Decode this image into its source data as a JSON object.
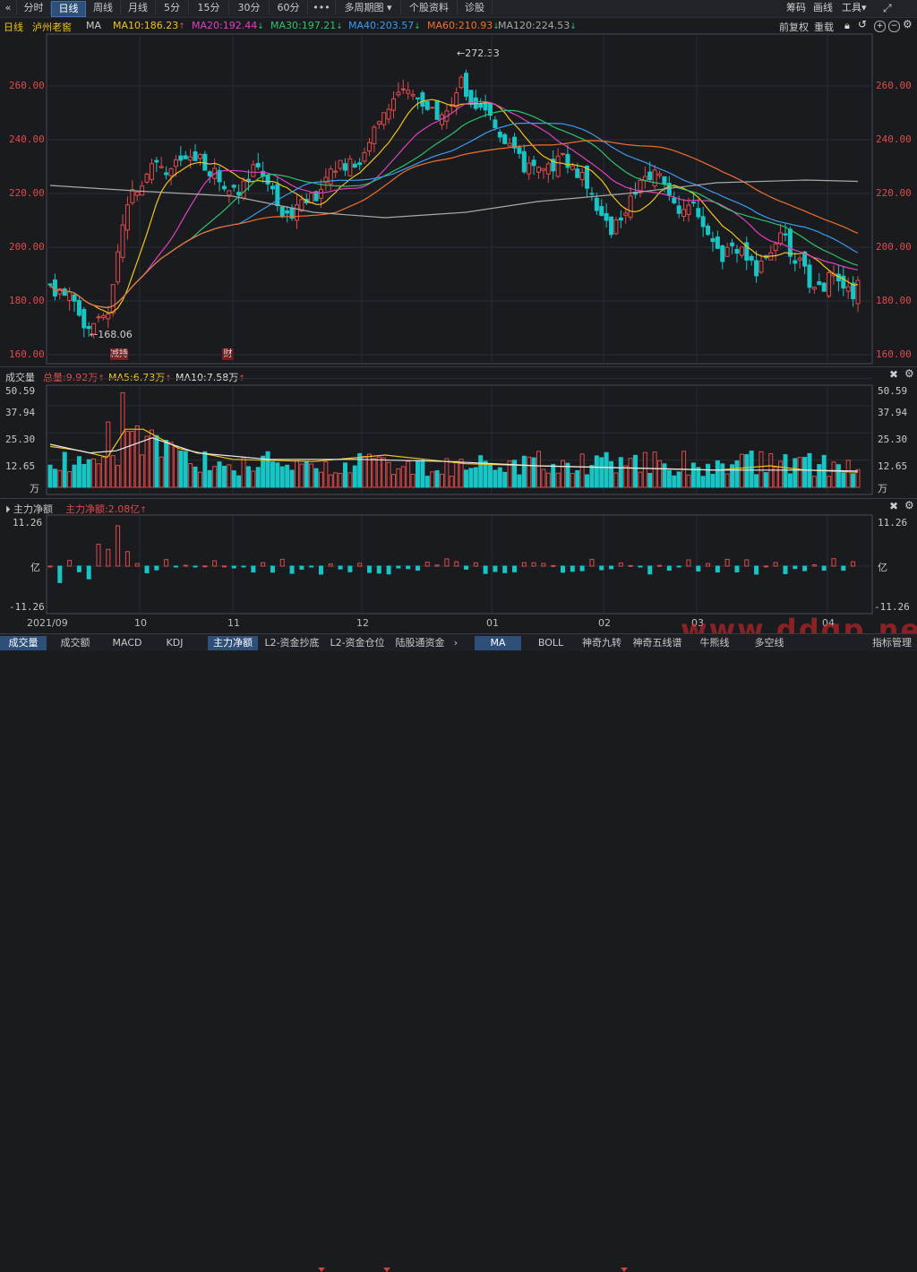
{
  "toolbar": {
    "back_icon": "double-chevron-left-icon",
    "periods": [
      "分时",
      "日线",
      "周线",
      "月线",
      "5分",
      "15分",
      "30分",
      "60分",
      "•••",
      "多周期图",
      "个股资料",
      "诊股"
    ],
    "active_period": "日线",
    "right_items": [
      "筹码",
      "画线",
      "工具"
    ],
    "icons": [
      "chevron-down-icon",
      "expand-icon"
    ]
  },
  "info": {
    "period": "日线",
    "stock_name": "泸州老窖",
    "indicator": "MA",
    "ma_values": [
      {
        "label": "MA10:186.23",
        "color": "#f0c419",
        "dir": "up"
      },
      {
        "label": "MA20:192.44",
        "color": "#e040c0",
        "dir": "down"
      },
      {
        "label": "MA30:197.21",
        "color": "#2ec26b",
        "dir": "down"
      },
      {
        "label": "MA40:203.57",
        "color": "#3a9bf0",
        "dir": "down"
      },
      {
        "label": "MA60:210.93",
        "color": "#f0702a",
        "dir": "down"
      },
      {
        "label": "MA120:224.53",
        "color": "#a8a8a8",
        "dir": "down"
      }
    ],
    "right_items": [
      "前复权",
      "重载"
    ],
    "right_icons": [
      "lock-icon",
      "undo-icon",
      "zoom-in-icon",
      "zoom-out-icon",
      "settings-icon"
    ]
  },
  "price_axis": {
    "labels": [
      "260.00",
      "240.00",
      "220.00",
      "200.00",
      "180.00",
      "160.00"
    ],
    "color": "#e04a4a"
  },
  "annotations": {
    "high": "272.33",
    "low": "168.06",
    "markers": [
      "减持",
      "财"
    ]
  },
  "volume_panel": {
    "title": "成交量",
    "total": "总量:9.92万",
    "ma5": "MA5:6.73万",
    "ma10": "MA10:7.58万",
    "axis": [
      "50.59",
      "37.94",
      "25.30",
      "12.65",
      "万"
    ]
  },
  "flow_panel": {
    "title": "主力净额",
    "value": "主力净额:2.08亿",
    "axis": [
      "11.26",
      "亿",
      "-11.26"
    ]
  },
  "x_axis": {
    "labels": [
      "2021/09",
      "10",
      "11",
      "12",
      "01",
      "02",
      "03",
      "04"
    ]
  },
  "bottom_tabs": [
    "成交量",
    "成交额",
    "MACD",
    "KDJ",
    "主力净额",
    "L2-资金抄底",
    "L2-资金仓位",
    "陆股通资金",
    "MA",
    "BOLL",
    "神奇九转",
    "神奇五线谱",
    "牛熊线",
    "多空线",
    "指标管理"
  ],
  "active_tabs": [
    "成交量",
    "主力净额",
    "MA"
  ],
  "watermark": "www.ddgp.net",
  "colors": {
    "up": "#e04a4a",
    "down": "#19c4c4",
    "background": "#1a1b1f"
  },
  "chart_data": {
    "type": "candlestick",
    "title": "",
    "xlabel": "",
    "ylabel": "",
    "ylim": [
      156,
      276
    ],
    "x_ticks": [
      "2021/09",
      "10",
      "11",
      "12",
      "01",
      "02",
      "03",
      "04"
    ],
    "key_points": [
      {
        "date": "2021/09 (early)",
        "close": 186
      },
      {
        "date": "2021/09 (low)",
        "low": 168.06
      },
      {
        "date": "2021/10",
        "close": 232
      },
      {
        "date": "2021/11",
        "close": 218
      },
      {
        "date": "2021/12 (late)",
        "high": 272.33
      },
      {
        "date": "2022/01",
        "close": 240
      },
      {
        "date": "2022/02",
        "close": 225
      },
      {
        "date": "2022/03",
        "close": 200
      },
      {
        "date": "2022/04",
        "close": 186
      }
    ],
    "series": [
      {
        "name": "MA10",
        "value": 186.23
      },
      {
        "name": "MA20",
        "value": 192.44
      },
      {
        "name": "MA30",
        "value": 197.21
      },
      {
        "name": "MA40",
        "value": 203.57
      },
      {
        "name": "MA60",
        "value": 210.93
      },
      {
        "name": "MA120",
        "value": 224.53
      }
    ],
    "volume_axis": [
      50.59,
      37.94,
      25.3,
      12.65
    ],
    "flow_axis": [
      11.26,
      -11.26
    ]
  }
}
